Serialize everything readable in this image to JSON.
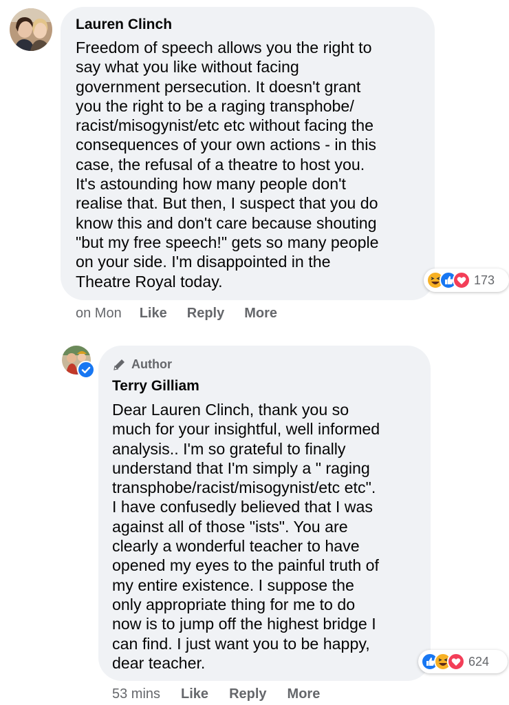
{
  "comment1": {
    "author": "Lauren Clinch",
    "text": "Freedom of speech allows you the right to\nsay what you like without facing\ngovernment persecution. It doesn't grant\nyou the right to be a raging transphobe/\nracist/misogynist/etc etc without facing the\nconsequences of your own actions - in this\ncase, the refusal of a theatre to host you.\nIt's astounding how many people don't\nrealise that. But then, I suspect that you do\nknow this and don't care because shouting\n\"but my free speech!\" gets so many people\non your side. I'm disappointed in the\nTheatre Royal today.",
    "reactions": {
      "icons": [
        "haha-icon",
        "like-icon",
        "love-icon"
      ],
      "count": "173"
    },
    "timestamp": "on Mon",
    "actions": {
      "like": "Like",
      "reply": "Reply",
      "more": "More"
    }
  },
  "comment2": {
    "badge": "Author",
    "author": "Terry Gilliam",
    "text": "Dear Lauren Clinch, thank you so\nmuch for your insightful, well informed\nanalysis.. I'm so grateful to finally\nunderstand that I'm simply a \" raging\ntransphobe/racist/misogynist/etc etc\".\nI have confusedly believed that I was\nagainst all of those \"ists\". You are\nclearly a wonderful teacher to have\nopened my eyes to the painful truth of\nmy entire existence. I suppose the\nonly appropriate thing for me to do\nnow is to jump off the highest bridge I\ncan find. I just want you to be happy,\ndear teacher.",
    "reactions": {
      "icons": [
        "like-icon",
        "haha-icon",
        "love-icon"
      ],
      "count": "624"
    },
    "timestamp": "53 mins",
    "actions": {
      "like": "Like",
      "reply": "Reply",
      "more": "More"
    }
  },
  "colors": {
    "bubble": "#f0f2f5",
    "meta_text": "#65676b",
    "like_blue": "#1877f2",
    "love_red": "#f33e58",
    "haha_yellow": "#f7b125"
  }
}
